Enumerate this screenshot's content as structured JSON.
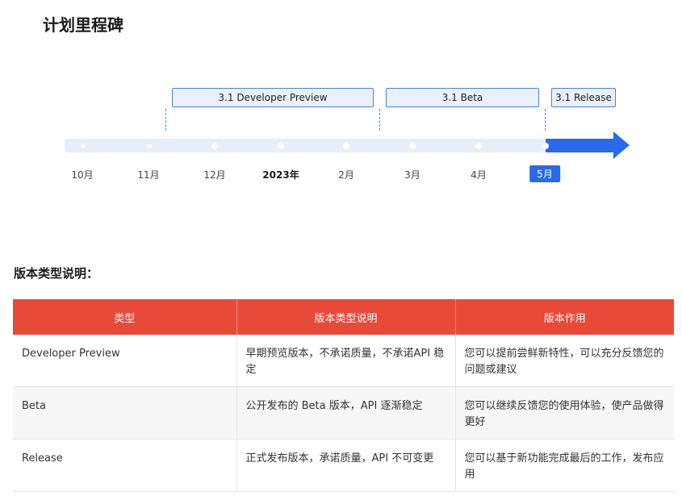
{
  "page_title": "计划里程碑",
  "timeline": {
    "phases": [
      {
        "label": "3.1 Developer Preview"
      },
      {
        "label": "3.1 Beta"
      },
      {
        "label": "3.1 Release"
      }
    ],
    "ticks": [
      "10月",
      "11月",
      "12月",
      "2023年",
      "2月",
      "3月",
      "4月",
      "5月"
    ],
    "current_tick": "5月",
    "accent_color": "#2a6ae8"
  },
  "section_title": "版本类型说明：",
  "table": {
    "header_color": "#e84a3a",
    "headers": [
      "类型",
      "版本类型说明",
      "版本作用"
    ],
    "rows": [
      [
        "Developer Preview",
        "早期预览版本，不承诺质量，不承诺API 稳定",
        "您可以提前尝鲜新特性，可以充分反馈您的问题或建议"
      ],
      [
        "Beta",
        "公开发布的 Beta 版本，API 逐渐稳定",
        "您可以继续反馈您的使用体验，使产品做得更好"
      ],
      [
        "Release",
        "正式发布版本，承诺质量，API 不可变更",
        "您可以基于新功能完成最后的工作，发布应用"
      ]
    ]
  }
}
